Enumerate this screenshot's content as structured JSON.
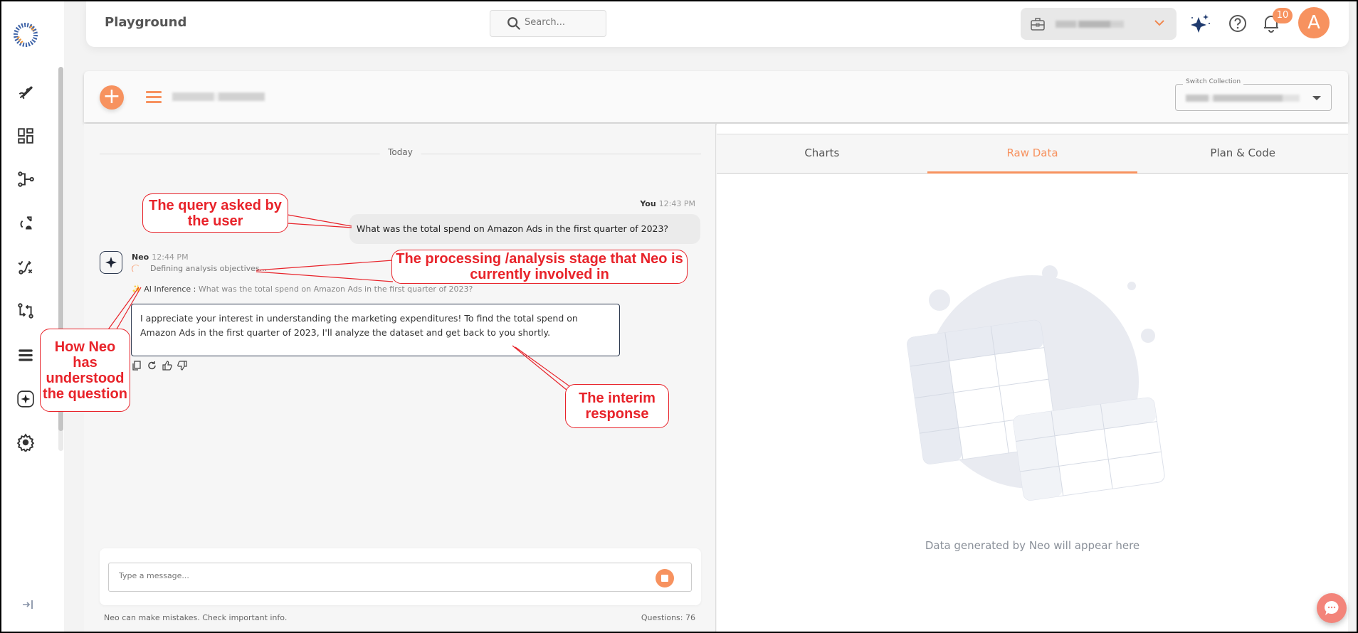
{
  "app": {
    "title": "Playground"
  },
  "search": {
    "placeholder": "Search..."
  },
  "header": {
    "workspace_label": "[redacted workspace]",
    "notifications_count": "10",
    "avatar_initial": "A"
  },
  "conversation": {
    "name": "[redacted conversation name]",
    "switch_collection_label": "Switch Collection",
    "collection_value": "[redacted collection]"
  },
  "chat": {
    "date_divider": "Today",
    "user_message": {
      "author": "You",
      "time": "12:43 PM",
      "text": "What was the total spend on Amazon Ads in the first quarter of 2023?"
    },
    "neo_message": {
      "author": "Neo",
      "time": "12:44 PM",
      "stage": "Defining analysis objectives...",
      "inference_label": "AI Inference :",
      "inference_text": "What was the total spend on Amazon Ads in the first quarter of 2023?",
      "reply_line1": "I appreciate your interest in understanding the marketing expenditures! To find the total spend on",
      "reply_line2": "Amazon Ads in the first quarter of 2023, I'll analyze the dataset and get back to you shortly.",
      "actions": [
        "copy-icon",
        "regenerate-icon",
        "thumbs-up-icon",
        "thumbs-down-icon"
      ]
    },
    "composer": {
      "placeholder": "Type a message..."
    },
    "disclaimer": "Neo can make mistakes. Check important info.",
    "questions_count": "Questions: 76"
  },
  "panel": {
    "tabs": [
      {
        "label": "Charts",
        "active": false
      },
      {
        "label": "Raw Data",
        "active": true
      },
      {
        "label": "Plan & Code",
        "active": false
      }
    ],
    "empty_text": "Data generated by Neo will appear here"
  },
  "sidebar": {
    "items": [
      "rocket-icon",
      "dashboard-icon",
      "flow-icon",
      "sync-upload-icon",
      "route-icon",
      "compare-icon",
      "list-icon",
      "neo-icon",
      "settings-icon"
    ],
    "collapse_icon": "collapse-right-icon"
  },
  "annotations": {
    "query": "The query asked by the user",
    "stage": "The processing /analysis stage that Neo is currently involved in",
    "inference": "How Neo has understood the question",
    "interim": "The interim response"
  },
  "colors": {
    "accent": "#f7925f",
    "navy": "#1f3a6e",
    "annotation_red": "#e8232a"
  }
}
